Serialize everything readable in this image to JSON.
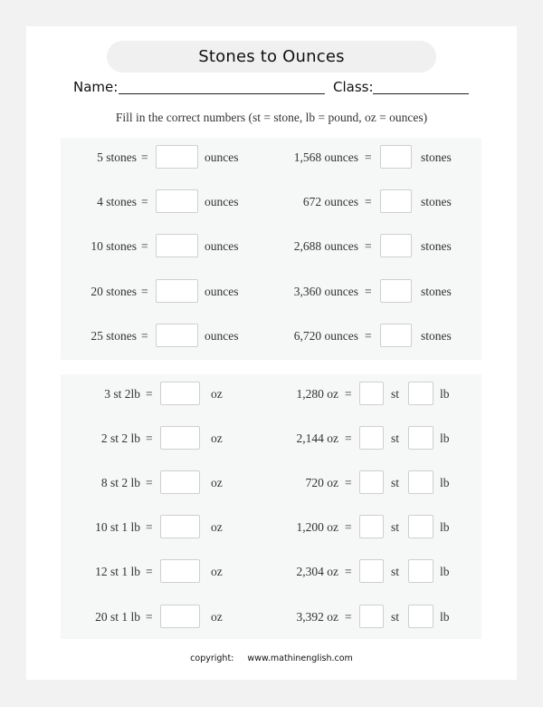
{
  "title": "Stones to Ounces",
  "name_label": "Name:",
  "class_label": "Class:",
  "instructions": "Fill in the correct numbers (st = stone, lb = pound, oz = ounces)",
  "equals": "=",
  "section1": {
    "left": [
      {
        "given": "5 stones",
        "unit": "ounces"
      },
      {
        "given": "4 stones",
        "unit": "ounces"
      },
      {
        "given": "10 stones",
        "unit": "ounces"
      },
      {
        "given": "20 stones",
        "unit": "ounces"
      },
      {
        "given": "25 stones",
        "unit": "ounces"
      }
    ],
    "right": [
      {
        "given": "1,568 ounces",
        "unit": "stones"
      },
      {
        "given": "672 ounces",
        "unit": "stones"
      },
      {
        "given": "2,688 ounces",
        "unit": "stones"
      },
      {
        "given": "3,360 ounces",
        "unit": "stones"
      },
      {
        "given": "6,720 ounces",
        "unit": "stones"
      }
    ]
  },
  "section2": {
    "left": [
      {
        "given": "3 st 2lb",
        "unit": "oz"
      },
      {
        "given": "2 st 2 lb",
        "unit": "oz"
      },
      {
        "given": "8 st 2 lb",
        "unit": "oz"
      },
      {
        "given": "10 st 1 lb",
        "unit": "oz"
      },
      {
        "given": "12 st 1 lb",
        "unit": "oz"
      },
      {
        "given": "20 st 1 lb",
        "unit": "oz"
      }
    ],
    "right": [
      {
        "given": "1,280 oz",
        "unit1": "st",
        "unit2": "lb"
      },
      {
        "given": "2,144 oz",
        "unit1": "st",
        "unit2": "lb"
      },
      {
        "given": "720 oz",
        "unit1": "st",
        "unit2": "lb"
      },
      {
        "given": "1,200 oz",
        "unit1": "st",
        "unit2": "lb"
      },
      {
        "given": "2,304 oz",
        "unit1": "st",
        "unit2": "lb"
      },
      {
        "given": "3,392 oz",
        "unit1": "st",
        "unit2": "lb"
      }
    ]
  },
  "footer": {
    "label": "copyright:",
    "site": "www.mathinenglish.com"
  }
}
